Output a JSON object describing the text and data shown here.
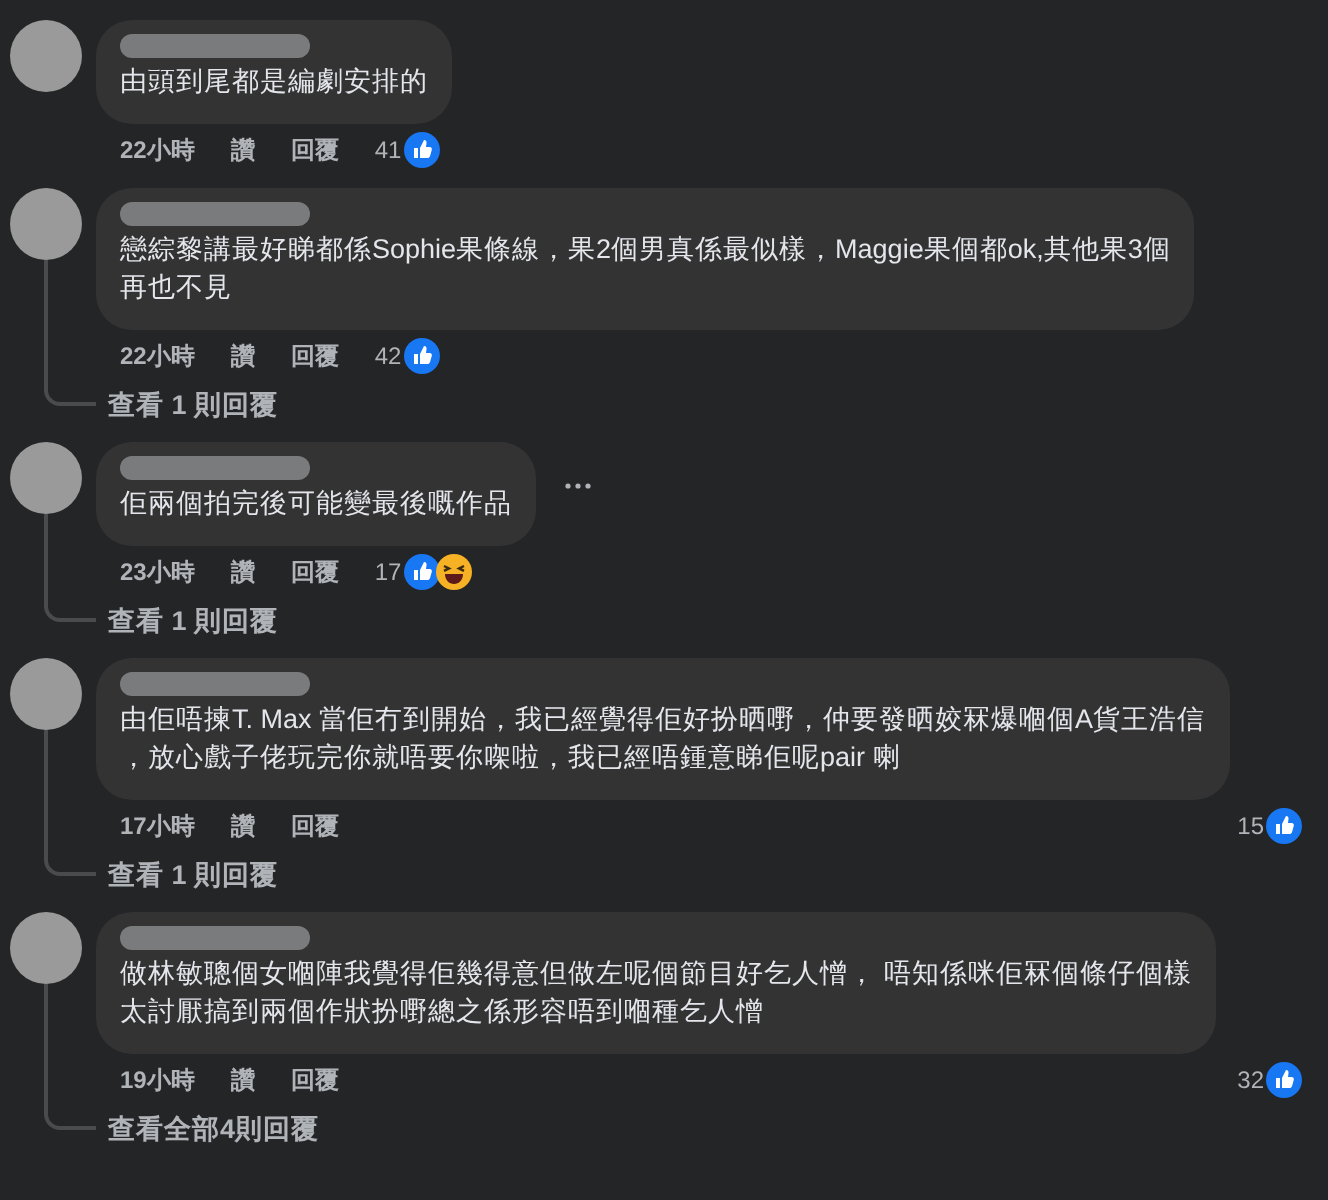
{
  "comments": [
    {
      "lines": [
        "由頭到尾都是編劇安排的"
      ],
      "time": "22小時",
      "actions": [
        "讚",
        "回覆"
      ],
      "reaction_count": "41",
      "reactions": [
        {
          "kind": "like"
        }
      ],
      "reactions_inline": true,
      "more_menu": false
    },
    {
      "lines": [
        "戀綜黎講最好睇都係Sophie果條線，果2個男真係最似樣，Maggie果個都ok,其他果3個",
        "再也不見"
      ],
      "time": "22小時",
      "actions": [
        "讚",
        "回覆"
      ],
      "reaction_count": "42",
      "reactions": [
        {
          "kind": "like"
        }
      ],
      "reactions_inline": true,
      "more_menu": false,
      "replies_link": "查看 1 則回覆"
    },
    {
      "lines": [
        "佢兩個拍完後可能變最後嘅作品"
      ],
      "time": "23小時",
      "actions": [
        "讚",
        "回覆"
      ],
      "reaction_count": "17",
      "reactions": [
        {
          "kind": "like"
        },
        {
          "kind": "haha"
        }
      ],
      "reactions_inline": true,
      "more_menu": true,
      "replies_link": "查看 1 則回覆"
    },
    {
      "lines": [
        "由佢唔揀T. Max 當佢冇到開始，我已經覺得佢好扮晒嘢，仲要發晒姣冧爆嗰個A貨王浩信",
        "，放心戲子佬玩完你就唔要你㗎啦，我已經唔鍾意睇佢呢pair 喇"
      ],
      "time": "17小時",
      "actions": [
        "讚",
        "回覆"
      ],
      "reaction_count": "15",
      "reactions": [
        {
          "kind": "like"
        }
      ],
      "reactions_inline": false,
      "more_menu": false,
      "replies_link": "查看 1 則回覆"
    },
    {
      "lines": [
        "做林敏聰個女嗰陣我覺得佢幾得意但做左呢個節目好乞人憎， 唔知係咪佢冧個條仔個樣",
        "太討厭搞到兩個作狀扮嘢總之係形容唔到嗰種乞人憎"
      ],
      "time": "19小時",
      "actions": [
        "讚",
        "回覆"
      ],
      "reaction_count": "32",
      "reactions": [
        {
          "kind": "like"
        }
      ],
      "reactions_inline": false,
      "more_menu": false,
      "replies_link": "查看全部4則回覆"
    }
  ]
}
